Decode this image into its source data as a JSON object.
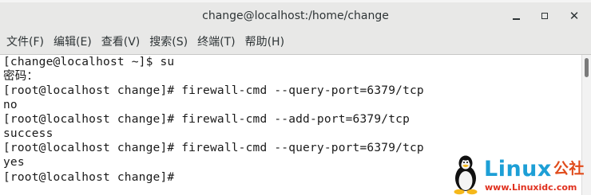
{
  "window": {
    "title": "change@localhost:/home/change"
  },
  "menu": [
    {
      "label": "文件(F)"
    },
    {
      "label": "编辑(E)"
    },
    {
      "label": "查看(V)"
    },
    {
      "label": "搜索(S)"
    },
    {
      "label": "终端(T)"
    },
    {
      "label": "帮助(H)"
    }
  ],
  "terminal": {
    "lines": [
      "[change@localhost ~]$ su",
      "密码：",
      "[root@localhost change]# firewall-cmd --query-port=6379/tcp",
      "no",
      "[root@localhost change]# firewall-cmd --add-port=6379/tcp",
      "success",
      "[root@localhost change]# firewall-cmd --query-port=6379/tcp",
      "yes",
      "[root@localhost change]# "
    ]
  },
  "watermark": {
    "brand": "Linux",
    "brand_cn": "公社",
    "url": "www.Linuxidc.com",
    "brand_color": "#1d9fd6",
    "url_color": "#e0301e"
  },
  "colors": {
    "titlebar": "#e8e8e7",
    "terminal_bg": "#ffffff",
    "terminal_fg": "#1a1a1a"
  },
  "icons": {
    "minimize": "minimize-icon",
    "maximize": "maximize-icon",
    "close": "close-icon",
    "mascot": "tux-penguin-icon"
  }
}
